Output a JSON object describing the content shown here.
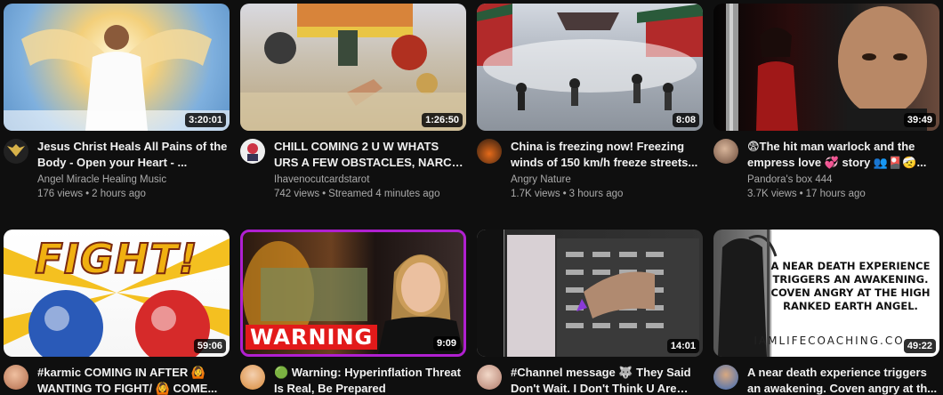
{
  "videos": [
    {
      "title": "Jesus Christ Heals All Pains of the Body - Open your Heart - ...",
      "channel": "Angel Miracle Healing Music",
      "views": "176 views",
      "age": "2 hours ago",
      "duration": "3:20:01"
    },
    {
      "title": "CHILL COMING 2 U W WHATS URS A FEW OBSTACLES, NARC DOIN...",
      "channel": "Ihavenocutcardstarot",
      "views": "742 views",
      "age": "Streamed 4 minutes ago",
      "duration": "1:26:50"
    },
    {
      "title": "China is freezing now! Freezing winds of 150 km/h freeze streets...",
      "channel": "Angry Nature",
      "views": "1.7K views",
      "age": "3 hours ago",
      "duration": "8:08"
    },
    {
      "title": "😨The hit man warlock and the empress love 💞 story 👥🎴🤕...",
      "channel": "Pandora's box 444",
      "views": "3.7K views",
      "age": "17 hours ago",
      "duration": "39:49"
    },
    {
      "title": "#karmic COMING IN AFTER 🙆 WANTING TO FIGHT/ 🙆 COME...",
      "channel": "",
      "views": "",
      "age": "",
      "duration": "59:06",
      "thumb_text": "FIGHT!"
    },
    {
      "title": "🟢 Warning: Hyperinflation Threat Is Real, Be Prepared",
      "channel": "",
      "views": "",
      "age": "",
      "duration": "9:09",
      "thumb_text": "WARNING"
    },
    {
      "title": "#Channel message 🐺 They Said Don't Wait. I Don't Think U Are 🙉...",
      "channel": "",
      "views": "",
      "age": "",
      "duration": "14:01"
    },
    {
      "title": "A near death experience triggers an awakening. Coven angry at th...",
      "channel": "",
      "views": "",
      "age": "",
      "duration": "49:22",
      "thumb_text": "A NEAR DEATH EXPERIENCE TRIGGERS AN AWAKENING. COVEN ANGRY AT THE HIGH RANKED EARTH ANGEL.",
      "thumb_footer": "IAMLIFECOACHING.CO"
    }
  ]
}
